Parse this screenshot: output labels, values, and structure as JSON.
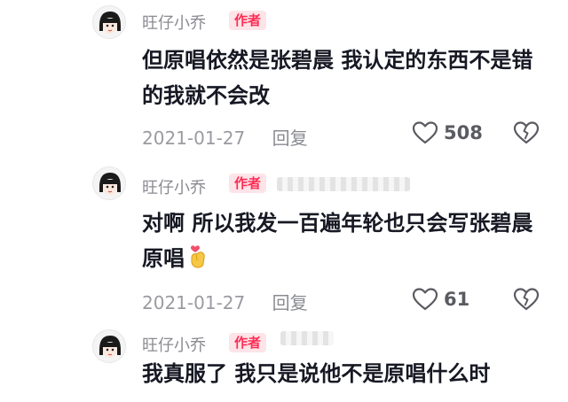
{
  "comments": [
    {
      "username": "旺仔小乔",
      "badge": "作者",
      "text": "但原唱依然是张碧晨 我认定的东西不是错的我就不会改",
      "date": "2021-01-27",
      "reply": "回复",
      "likes": "508"
    },
    {
      "username": "旺仔小乔",
      "badge": "作者",
      "text": "对啊 所以我发一百遍年轮也只会写张碧晨原唱",
      "date": "2021-01-27",
      "reply": "回复",
      "likes": "61"
    },
    {
      "username": "旺仔小乔",
      "badge": "作者",
      "text": "我真服了 我只是说他不是原唱什么时"
    }
  ],
  "icons": {
    "like": "heart-outline-icon",
    "dislike": "broken-heart-icon",
    "emoji": "finger-heart-emoji"
  },
  "colors": {
    "badge_bg": "#fde4e8",
    "badge_text": "#fe2c55",
    "meta_text": "#9a9ba1"
  }
}
